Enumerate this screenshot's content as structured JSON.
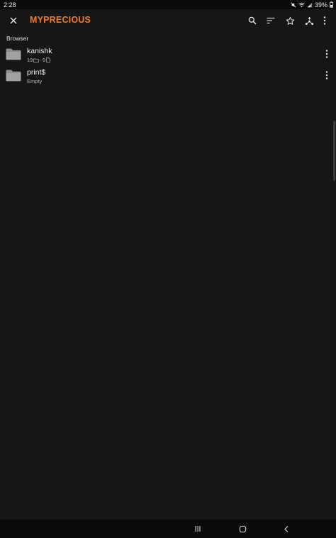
{
  "status_bar": {
    "time": "2:28",
    "battery": "39%"
  },
  "app_bar": {
    "title": "MYPRECIOUS",
    "accent_color": "#f57c21",
    "icons": [
      "close-icon",
      "search-icon",
      "sort-icon",
      "star-icon",
      "add-network-icon",
      "more-vertical-icon"
    ]
  },
  "section": {
    "label": "Browser"
  },
  "items": [
    {
      "name": "kanishk",
      "folders": "19",
      "separator": "·",
      "files": "9"
    },
    {
      "name": "print$",
      "meta": "Empty"
    }
  ],
  "nav_bar": {
    "icons": [
      "recents-icon",
      "home-icon",
      "back-icon"
    ]
  }
}
